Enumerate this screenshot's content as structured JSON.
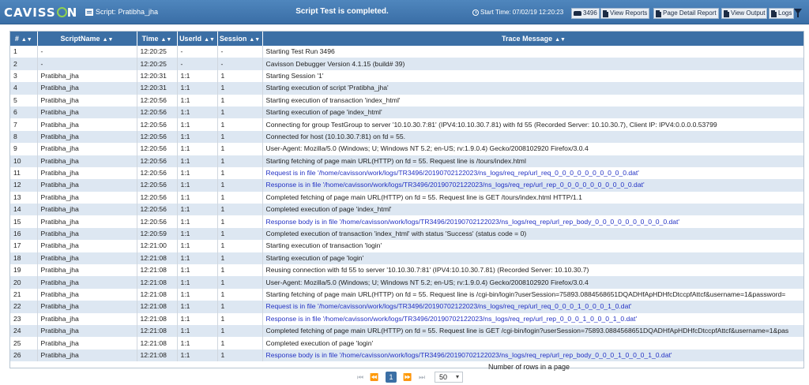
{
  "header": {
    "logo": "CAVISSON",
    "script_label": "Script:",
    "script_name": "Pratibha_jha",
    "title": "Script Test is completed.",
    "start_time_label": "Start Time:",
    "start_time_value": "07/02/19 12:20:23",
    "test_run": "3496",
    "buttons": {
      "view_reports": "View Reports",
      "page_detail_report": "Page Detail Report",
      "view_output": "View Output",
      "logs": "Logs"
    }
  },
  "table": {
    "columns": [
      "#",
      "ScriptName",
      "Time",
      "UserId",
      "Session",
      "Trace Message"
    ],
    "rows": [
      {
        "n": "1",
        "script": "-",
        "time": "12:20:25",
        "user": "-",
        "session": "-",
        "msg": "Starting Test Run 3496",
        "link": false
      },
      {
        "n": "2",
        "script": "-",
        "time": "12:20:25",
        "user": "-",
        "session": "-",
        "msg": "Cavisson Debugger Version 4.1.15 (build# 39)",
        "link": false
      },
      {
        "n": "3",
        "script": "Pratibha_jha",
        "time": "12:20:31",
        "user": "1:1",
        "session": "1",
        "msg": "Starting Session '1'",
        "link": false
      },
      {
        "n": "4",
        "script": "Pratibha_jha",
        "time": "12:20:31",
        "user": "1:1",
        "session": "1",
        "msg": "Starting execution of script 'Pratibha_jha'",
        "link": false
      },
      {
        "n": "5",
        "script": "Pratibha_jha",
        "time": "12:20:56",
        "user": "1:1",
        "session": "1",
        "msg": "Starting execution of transaction 'index_html'",
        "link": false
      },
      {
        "n": "6",
        "script": "Pratibha_jha",
        "time": "12:20:56",
        "user": "1:1",
        "session": "1",
        "msg": "Starting execution of page 'index_html'",
        "link": false
      },
      {
        "n": "7",
        "script": "Pratibha_jha",
        "time": "12:20:56",
        "user": "1:1",
        "session": "1",
        "msg": "Connecting for group TestGroup to server '10.10.30.7:81' (IPV4:10.10.30.7.81) with fd 55 (Recorded Server: 10.10.30.7), Client IP: IPV4:0.0.0.0.53799",
        "link": false
      },
      {
        "n": "8",
        "script": "Pratibha_jha",
        "time": "12:20:56",
        "user": "1:1",
        "session": "1",
        "msg": "Connected for host (10.10.30.7:81) on fd = 55.",
        "link": false
      },
      {
        "n": "9",
        "script": "Pratibha_jha",
        "time": "12:20:56",
        "user": "1:1",
        "session": "1",
        "msg": "User-Agent: Mozilla/5.0 (Windows; U; Windows NT 5.2; en-US; rv:1.9.0.4) Gecko/2008102920 Firefox/3.0.4",
        "link": false
      },
      {
        "n": "10",
        "script": "Pratibha_jha",
        "time": "12:20:56",
        "user": "1:1",
        "session": "1",
        "msg": "Starting fetching of page main URL(HTTP) on fd = 55. Request line is /tours/index.html",
        "link": false
      },
      {
        "n": "11",
        "script": "Pratibha_jha",
        "time": "12:20:56",
        "user": "1:1",
        "session": "1",
        "msg": "Request is in file '/home/cavisson/work/logs/TR3496/20190702122023/ns_logs/req_rep/url_req_0_0_0_0_0_0_0_0_0_0.dat'",
        "link": true
      },
      {
        "n": "12",
        "script": "Pratibha_jha",
        "time": "12:20:56",
        "user": "1:1",
        "session": "1",
        "msg": "Response is in file '/home/cavisson/work/logs/TR3496/20190702122023/ns_logs/req_rep/url_rep_0_0_0_0_0_0_0_0_0_0.dat'",
        "link": true
      },
      {
        "n": "13",
        "script": "Pratibha_jha",
        "time": "12:20:56",
        "user": "1:1",
        "session": "1",
        "msg": "Completed fetching of page main URL(HTTP) on fd = 55. Request line is GET /tours/index.html HTTP/1.1",
        "link": false
      },
      {
        "n": "14",
        "script": "Pratibha_jha",
        "time": "12:20:56",
        "user": "1:1",
        "session": "1",
        "msg": "Completed execution of page 'index_html'",
        "link": false
      },
      {
        "n": "15",
        "script": "Pratibha_jha",
        "time": "12:20:56",
        "user": "1:1",
        "session": "1",
        "msg": "Response body is in file '/home/cavisson/work/logs/TR3496/20190702122023/ns_logs/req_rep/url_rep_body_0_0_0_0_0_0_0_0_0_0.dat'",
        "link": true
      },
      {
        "n": "16",
        "script": "Pratibha_jha",
        "time": "12:20:59",
        "user": "1:1",
        "session": "1",
        "msg": "Completed execution of transaction 'index_html' with status 'Success' (status code = 0)",
        "link": false
      },
      {
        "n": "17",
        "script": "Pratibha_jha",
        "time": "12:21:00",
        "user": "1:1",
        "session": "1",
        "msg": "Starting execution of transaction 'login'",
        "link": false
      },
      {
        "n": "18",
        "script": "Pratibha_jha",
        "time": "12:21:08",
        "user": "1:1",
        "session": "1",
        "msg": "Starting execution of page 'login'",
        "link": false
      },
      {
        "n": "19",
        "script": "Pratibha_jha",
        "time": "12:21:08",
        "user": "1:1",
        "session": "1",
        "msg": "Reusing connection with fd 55 to server '10.10.30.7:81' (IPV4:10.10.30.7.81) (Recorded Server: 10.10.30.7)",
        "link": false
      },
      {
        "n": "20",
        "script": "Pratibha_jha",
        "time": "12:21:08",
        "user": "1:1",
        "session": "1",
        "msg": "User-Agent: Mozilla/5.0 (Windows; U; Windows NT 5.2; en-US; rv:1.9.0.4) Gecko/2008102920 Firefox/3.0.4",
        "link": false
      },
      {
        "n": "21",
        "script": "Pratibha_jha",
        "time": "12:21:08",
        "user": "1:1",
        "session": "1",
        "msg": "Starting fetching of page main URL(HTTP) on fd = 55. Request line is /cgi-bin/login?userSession=75893.0884568651DQADHfApHDHfcDtccpfAttcf&username=1&password=",
        "link": false
      },
      {
        "n": "22",
        "script": "Pratibha_jha",
        "time": "12:21:08",
        "user": "1:1",
        "session": "1",
        "msg": "Request is in file '/home/cavisson/work/logs/TR3496/20190702122023/ns_logs/req_rep/url_req_0_0_0_1_0_0_0_1_0.dat'",
        "link": true
      },
      {
        "n": "23",
        "script": "Pratibha_jha",
        "time": "12:21:08",
        "user": "1:1",
        "session": "1",
        "msg": "Response is in file '/home/cavisson/work/logs/TR3496/20190702122023/ns_logs/req_rep/url_rep_0_0_0_1_0_0_0_1_0.dat'",
        "link": true
      },
      {
        "n": "24",
        "script": "Pratibha_jha",
        "time": "12:21:08",
        "user": "1:1",
        "session": "1",
        "msg": "Completed fetching of page main URL(HTTP) on fd = 55. Request line is GET /cgi-bin/login?userSession=75893.0884568651DQADHfApHDHfcDtccpfAttcf&username=1&pas",
        "link": false
      },
      {
        "n": "25",
        "script": "Pratibha_jha",
        "time": "12:21:08",
        "user": "1:1",
        "session": "1",
        "msg": "Completed execution of page 'login'",
        "link": false
      },
      {
        "n": "26",
        "script": "Pratibha_jha",
        "time": "12:21:08",
        "user": "1:1",
        "session": "1",
        "msg": "Response body is in file '/home/cavisson/work/logs/TR3496/20190702122023/ns_logs/req_rep/url_rep_body_0_0_0_1_0_0_0_1_0.dat'",
        "link": true
      }
    ]
  },
  "pager": {
    "current_page": "1",
    "rows_per_page": "50",
    "rows_label": "Number of rows in a page"
  },
  "icons": {
    "clock": "clock-icon",
    "filter": "filter-icon",
    "first": "⏮",
    "prev": "⏪",
    "next": "⏩",
    "last": "⏭"
  },
  "colors": {
    "header_bg": "#3a6ea6",
    "row_alt": "#dde7f2",
    "link": "#2332c4"
  }
}
